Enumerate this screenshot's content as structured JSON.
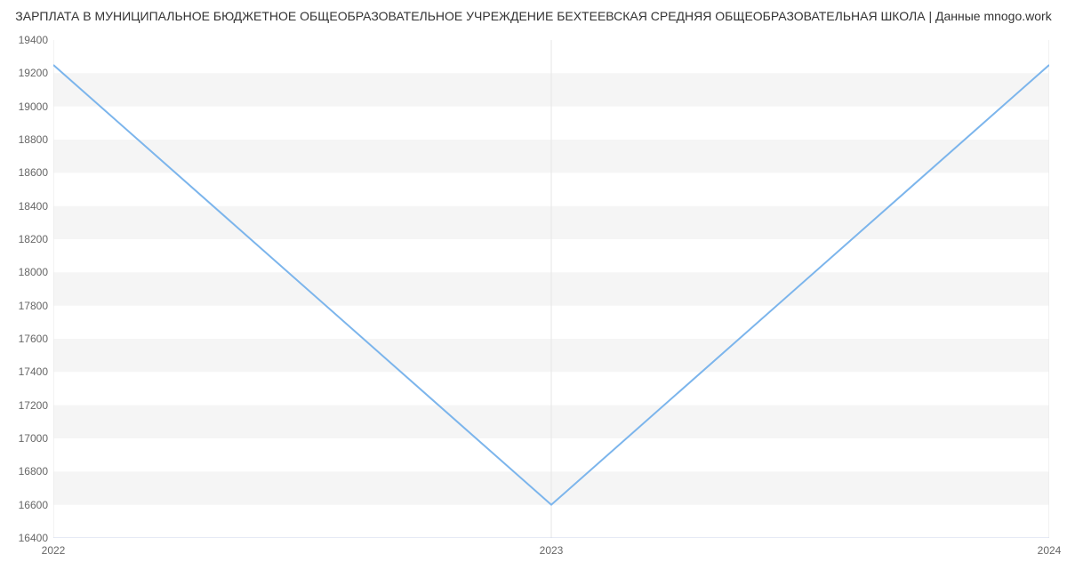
{
  "chart_data": {
    "type": "line",
    "title": "ЗАРПЛАТА В МУНИЦИПАЛЬНОЕ БЮДЖЕТНОЕ ОБЩЕОБРАЗОВАТЕЛЬНОЕ УЧРЕЖДЕНИЕ БЕХТЕЕВСКАЯ СРЕДНЯЯ ОБЩЕОБРАЗОВАТЕЛЬНАЯ ШКОЛА | Данные mnogo.work",
    "xlabel": "",
    "ylabel": "",
    "x": [
      2022,
      2023,
      2024
    ],
    "values": [
      19250,
      16600,
      19250
    ],
    "x_ticks": [
      2022,
      2023,
      2024
    ],
    "y_ticks": [
      16400,
      16600,
      16800,
      17000,
      17200,
      17400,
      17600,
      17800,
      18000,
      18200,
      18400,
      18600,
      18800,
      19000,
      19200,
      19400
    ],
    "ylim": [
      16400,
      19400
    ],
    "xlim": [
      2022,
      2024
    ],
    "line_color": "#7cb5ec",
    "grid_band_color": "#f5f5f5"
  }
}
